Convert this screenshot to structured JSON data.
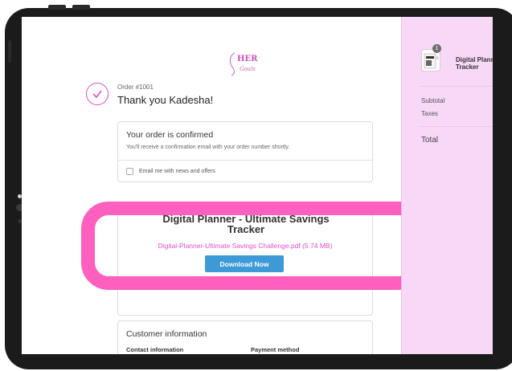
{
  "brand": {
    "accent": "#e04fc8",
    "highlight": "#ff5fbf",
    "button": "#3d9ad6",
    "sidebar_bg": "#f7d8f7"
  },
  "logo": {
    "text": "HER",
    "script": "Goals"
  },
  "order": {
    "number": "Order #1001",
    "thanks": "Thank you Kadesha!"
  },
  "confirmation": {
    "title": "Your order is confirmed",
    "subtitle": "You'll receive a confirmation email with your order number shortly.",
    "newsletter_label": "Email me with news and offers"
  },
  "download": {
    "title_line1": "Digital Planner - Ultimate Savings",
    "title_line2": "Tracker",
    "file": "Digital-Planner-Ultimate Savings Challenge.pdf (5.74 MB)",
    "button_label": "Download Now"
  },
  "customer": {
    "title": "Customer information",
    "contact_label": "Contact information",
    "payment_label": "Payment method"
  },
  "summary": {
    "quantity_badge": "1",
    "product_line1": "Digital Plann",
    "product_line2": "Tracker",
    "subtotal_label": "Subtotal",
    "taxes_label": "Taxes",
    "total_label": "Total"
  }
}
